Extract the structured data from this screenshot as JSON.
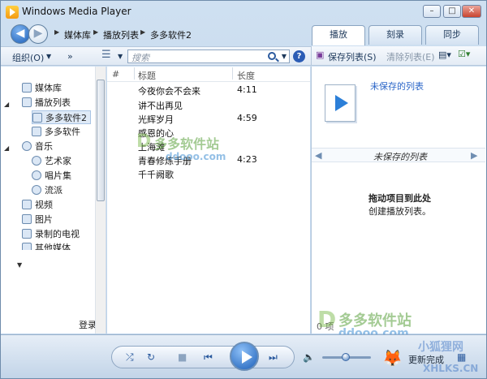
{
  "window": {
    "title": "Windows Media Player"
  },
  "nav": {
    "breadcrumb": [
      "媒体库",
      "播放列表",
      "多多软件2"
    ]
  },
  "tabs": [
    "播放",
    "刻录",
    "同步"
  ],
  "toolbar": {
    "organize": "组织(O)",
    "more": "»",
    "search_placeholder": "搜索"
  },
  "right_toolbar": {
    "save_list": "保存列表(S)",
    "clear_list": "清除列表(E)"
  },
  "sidebar": {
    "items": [
      {
        "label": "媒体库"
      },
      {
        "label": "播放列表"
      },
      {
        "label": "多多软件2",
        "selected": true
      },
      {
        "label": "多多软件"
      },
      {
        "label": "音乐"
      },
      {
        "label": "艺术家"
      },
      {
        "label": "唱片集"
      },
      {
        "label": "流派"
      },
      {
        "label": "视频"
      },
      {
        "label": "图片"
      },
      {
        "label": "录制的电视"
      },
      {
        "label": "其他媒体"
      }
    ],
    "login": "登录"
  },
  "list": {
    "columns": [
      "#",
      "标题",
      "长度"
    ],
    "rows": [
      {
        "title": "今夜你会不会来",
        "length": "4:11"
      },
      {
        "title": "讲不出再见",
        "length": ""
      },
      {
        "title": "光辉岁月",
        "length": "4:59"
      },
      {
        "title": "感恩的心",
        "length": ""
      },
      {
        "title": "上海滩",
        "length": ""
      },
      {
        "title": "青春修炼手册",
        "length": "4:23"
      },
      {
        "title": "千千阙歌",
        "length": ""
      }
    ]
  },
  "playlist": {
    "name": "未保存的列表",
    "bar_label": "未保存的列表",
    "drag_hint": "拖动项目到此处",
    "create_hint": "创建播放列表。",
    "count": "0 项"
  },
  "player": {
    "status": "更新完成"
  },
  "watermarks": {
    "main": "多多软件站",
    "main_sub": "ddooo.com",
    "bottom": "多多软件站",
    "bottom_sub": "ddooo.com",
    "corner": "小狐狸网",
    "corner_sub": "XHLKS.CN"
  }
}
